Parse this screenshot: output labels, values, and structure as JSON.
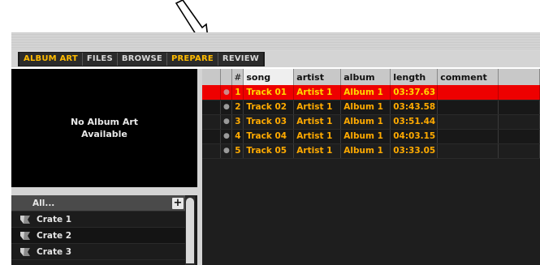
{
  "tabs": [
    {
      "label": "ALBUM ART",
      "color": "#ffbb00"
    },
    {
      "label": "FILES",
      "color": "#d8d8d8"
    },
    {
      "label": "BROWSE",
      "color": "#d8d8d8"
    },
    {
      "label": "PREPARE",
      "color": "#ffbb00"
    },
    {
      "label": "REVIEW",
      "color": "#d8d8d8"
    }
  ],
  "album_art": {
    "line1": "No Album Art",
    "line2": "Available"
  },
  "crates": {
    "all_label": "All...",
    "add_icon": "plus-icon",
    "items": [
      {
        "label": "Crate 1"
      },
      {
        "label": "Crate 2"
      },
      {
        "label": "Crate 3"
      }
    ]
  },
  "table": {
    "columns": [
      "",
      "#",
      "song",
      "artist",
      "album",
      "length",
      "comment"
    ],
    "sorted_column": "song",
    "rows": [
      {
        "num": "1",
        "song": "Track 01",
        "artist": "Artist 1",
        "album": "Album 1",
        "length": "03:37.63",
        "comment": "",
        "selected": true
      },
      {
        "num": "2",
        "song": "Track 02",
        "artist": "Artist 1",
        "album": "Album 1",
        "length": "03:43.58",
        "comment": "",
        "selected": false
      },
      {
        "num": "3",
        "song": "Track 03",
        "artist": "Artist 1",
        "album": "Album 1",
        "length": "03:51.44",
        "comment": "",
        "selected": false
      },
      {
        "num": "4",
        "song": "Track 04",
        "artist": "Artist 1",
        "album": "Album 1",
        "length": "04:03.15",
        "comment": "",
        "selected": false
      },
      {
        "num": "5",
        "song": "Track 05",
        "artist": "Artist 1",
        "album": "Album 1",
        "length": "03:33.05",
        "comment": "",
        "selected": false
      }
    ]
  },
  "colors": {
    "accent_gold": "#ffbb00",
    "selected_row": "#ee0000",
    "text_orange": "#ffaa00"
  }
}
